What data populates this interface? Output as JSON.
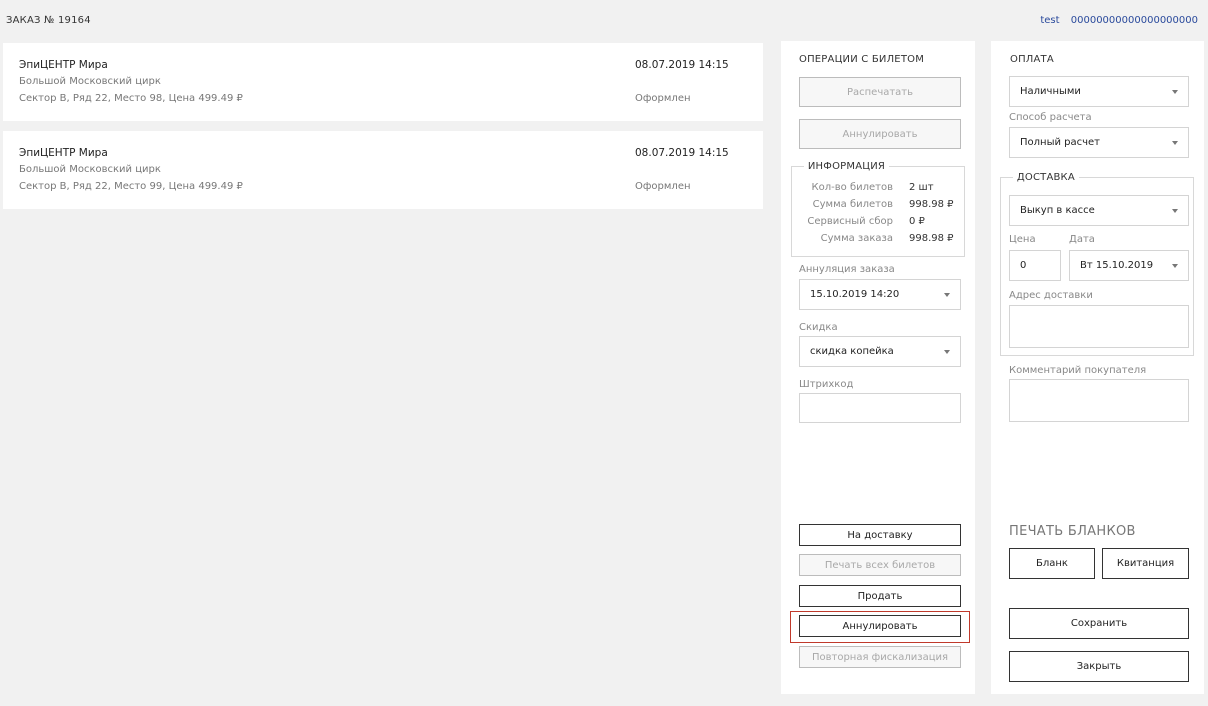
{
  "header": {
    "order_title": "ЗАКАЗ №  19164",
    "user": "test",
    "account": "00000000000000000000"
  },
  "tickets": [
    {
      "event": "ЭпиЦЕНТР Мира",
      "venue": "Большой Московский цирк",
      "seat": "Сектор В, Ряд 22, Место 98, Цена 499.49 ₽",
      "datetime": "08.07.2019 14:15",
      "status": "Оформлен"
    },
    {
      "event": "ЭпиЦЕНТР Мира",
      "venue": "Большой Московский цирк",
      "seat": "Сектор В, Ряд 22, Место 99, Цена 499.49 ₽",
      "datetime": "08.07.2019 14:15",
      "status": "Оформлен"
    }
  ],
  "operations": {
    "heading": "ОПЕРАЦИИ С БИЛЕТОМ",
    "print_label": "Распечатать",
    "cancel_ticket_label": "Аннулировать",
    "info": {
      "legend": "ИНФОРМАЦИЯ",
      "rows": [
        {
          "key": "Кол-во билетов",
          "value": "2 шт"
        },
        {
          "key": "Сумма билетов",
          "value": "998.98 ₽"
        },
        {
          "key": "Сервисный сбор",
          "value": "0 ₽"
        },
        {
          "key": "Сумма заказа",
          "value": "998.98 ₽"
        }
      ]
    },
    "annulment_label": "Аннуляция заказа",
    "annulment_value": "15.10.2019 14:20",
    "discount_label": "Скидка",
    "discount_value": "скидка копейка",
    "barcode_label": "Штрихкод",
    "barcode_value": "",
    "to_delivery_label": "На доставку",
    "print_all_label": "Печать всех билетов",
    "sell_label": "Продать",
    "cancel_order_label": "Аннулировать",
    "refiscal_label": "Повторная фискализация"
  },
  "payment": {
    "heading": "ОПЛАТА",
    "method_value": "Наличными",
    "calc_label": "Способ расчета",
    "calc_value": "Полный расчет"
  },
  "delivery": {
    "legend": "ДОСТАВКА",
    "type_value": "Выкуп в кассе",
    "price_label": "Цена",
    "price_value": "0",
    "date_label": "Дата",
    "date_value": "Вт 15.10.2019",
    "address_label": "Адрес доставки",
    "address_value": ""
  },
  "comment": {
    "label": "Комментарий покупателя",
    "value": ""
  },
  "print_forms": {
    "heading": "ПЕЧАТЬ БЛАНКОВ",
    "blank_label": "Бланк",
    "receipt_label": "Квитанция"
  },
  "actions": {
    "save_label": "Сохранить",
    "close_label": "Закрыть"
  }
}
